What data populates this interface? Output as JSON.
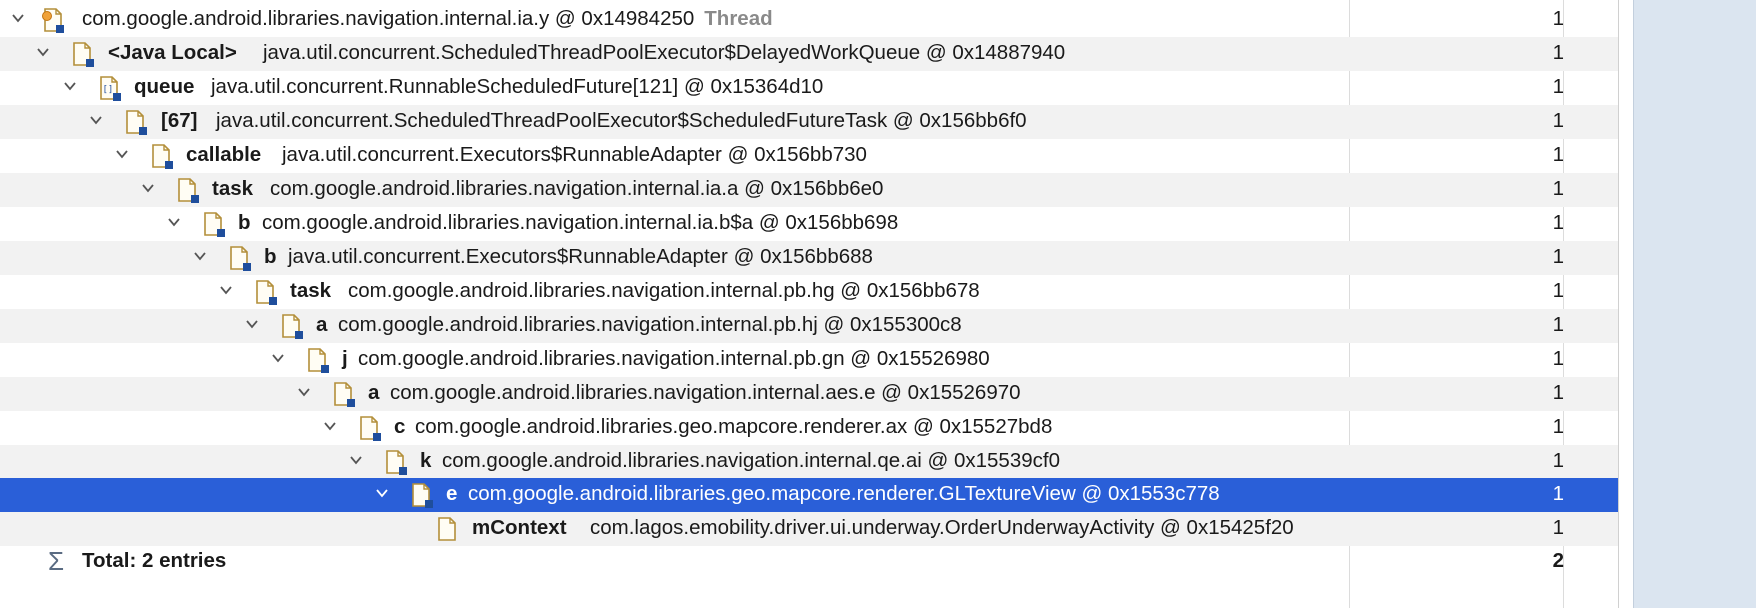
{
  "rows": [
    {
      "field": "",
      "value": "com.google.android.libraries.navigation.internal.ia.y @ 0x14984250",
      "suffix": "Thread",
      "count": "1",
      "icon": "thread-object-icon"
    },
    {
      "field": "<Java Local>",
      "value": "java.util.concurrent.ScheduledThreadPoolExecutor$DelayedWorkQueue @ 0x14887940",
      "count": "1",
      "icon": "object-icon"
    },
    {
      "field": "queue",
      "value": "java.util.concurrent.RunnableScheduledFuture[121] @ 0x15364d10",
      "count": "1",
      "icon": "array-icon"
    },
    {
      "field": "[67]",
      "value": "java.util.concurrent.ScheduledThreadPoolExecutor$ScheduledFutureTask @ 0x156bb6f0",
      "count": "1",
      "icon": "object-icon"
    },
    {
      "field": "callable",
      "value": "java.util.concurrent.Executors$RunnableAdapter @ 0x156bb730",
      "count": "1",
      "icon": "object-icon"
    },
    {
      "field": "task",
      "value": "com.google.android.libraries.navigation.internal.ia.a @ 0x156bb6e0",
      "count": "1",
      "icon": "object-icon"
    },
    {
      "field": "b",
      "value": "com.google.android.libraries.navigation.internal.ia.b$a @ 0x156bb698",
      "count": "1",
      "icon": "object-icon"
    },
    {
      "field": "b",
      "value": "java.util.concurrent.Executors$RunnableAdapter @ 0x156bb688",
      "count": "1",
      "icon": "object-icon"
    },
    {
      "field": "task",
      "value": "com.google.android.libraries.navigation.internal.pb.hg @ 0x156bb678",
      "count": "1",
      "icon": "object-icon"
    },
    {
      "field": "a",
      "value": "com.google.android.libraries.navigation.internal.pb.hj @ 0x155300c8",
      "count": "1",
      "icon": "object-icon"
    },
    {
      "field": "j",
      "value": "com.google.android.libraries.navigation.internal.pb.gn @ 0x15526980",
      "count": "1",
      "icon": "object-icon"
    },
    {
      "field": "a",
      "value": "com.google.android.libraries.navigation.internal.aes.e @ 0x15526970",
      "count": "1",
      "icon": "object-icon"
    },
    {
      "field": "c",
      "value": "com.google.android.libraries.geo.mapcore.renderer.ax @ 0x15527bd8",
      "count": "1",
      "icon": "object-icon"
    },
    {
      "field": "k",
      "value": "com.google.android.libraries.navigation.internal.qe.ai @ 0x15539cf0",
      "count": "1",
      "icon": "object-icon"
    },
    {
      "field": "e",
      "value": "com.google.android.libraries.geo.mapcore.renderer.GLTextureView @ 0x1553c778",
      "count": "1",
      "icon": "object-icon",
      "selected": true
    },
    {
      "field": "mContext",
      "value": "com.lagos.emobility.driver.ui.underway.OrderUnderwayActivity @ 0x15425f20",
      "count": "1",
      "icon": "object-icon",
      "leaf": true
    }
  ],
  "total": {
    "label": "Total: 2 entries",
    "count": "2",
    "icon": "sum-icon"
  }
}
